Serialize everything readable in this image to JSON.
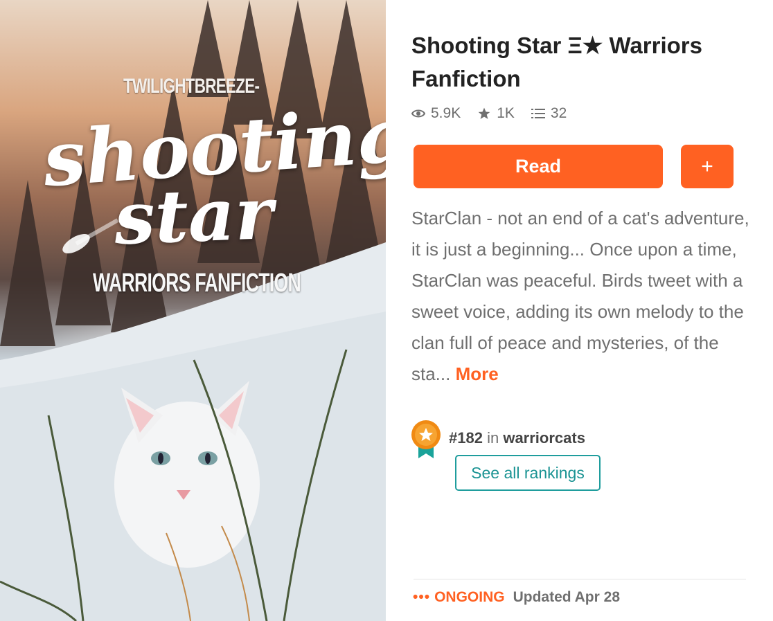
{
  "cover": {
    "author": "TWILIGHTBREEZE-",
    "script_line1": "shooting",
    "script_line2": "star",
    "subtitle": "WARRIORS FANFICTION"
  },
  "story": {
    "title": "Shooting Star Ξ★ Warriors Fanfiction",
    "stats": {
      "reads": "5.9K",
      "votes": "1K",
      "parts": "32"
    },
    "read_label": "Read",
    "add_label": "+",
    "description": "StarClan - not an end of a cat's adventure, it is just a beginning... Once upon a time, StarClan was peaceful. Birds tweet with a sweet voice, adding its own melody to the clan full of peace and mysteries, of the sta...",
    "more_label": "More",
    "ranking": {
      "rank": "#182",
      "in_word": "in",
      "tag": "warriorcats"
    },
    "see_rankings_label": "See all rankings",
    "status": {
      "dots": "•••",
      "state": "ONGOING",
      "updated": "Updated Apr 28"
    }
  },
  "colors": {
    "accent": "#ff6122",
    "teal": "#1f9d9d",
    "muted_text": "#6f6f6f"
  },
  "icons": {
    "reads": "eye-icon",
    "votes": "star-icon",
    "parts": "list-icon",
    "ranking": "ranking-medal-icon"
  }
}
